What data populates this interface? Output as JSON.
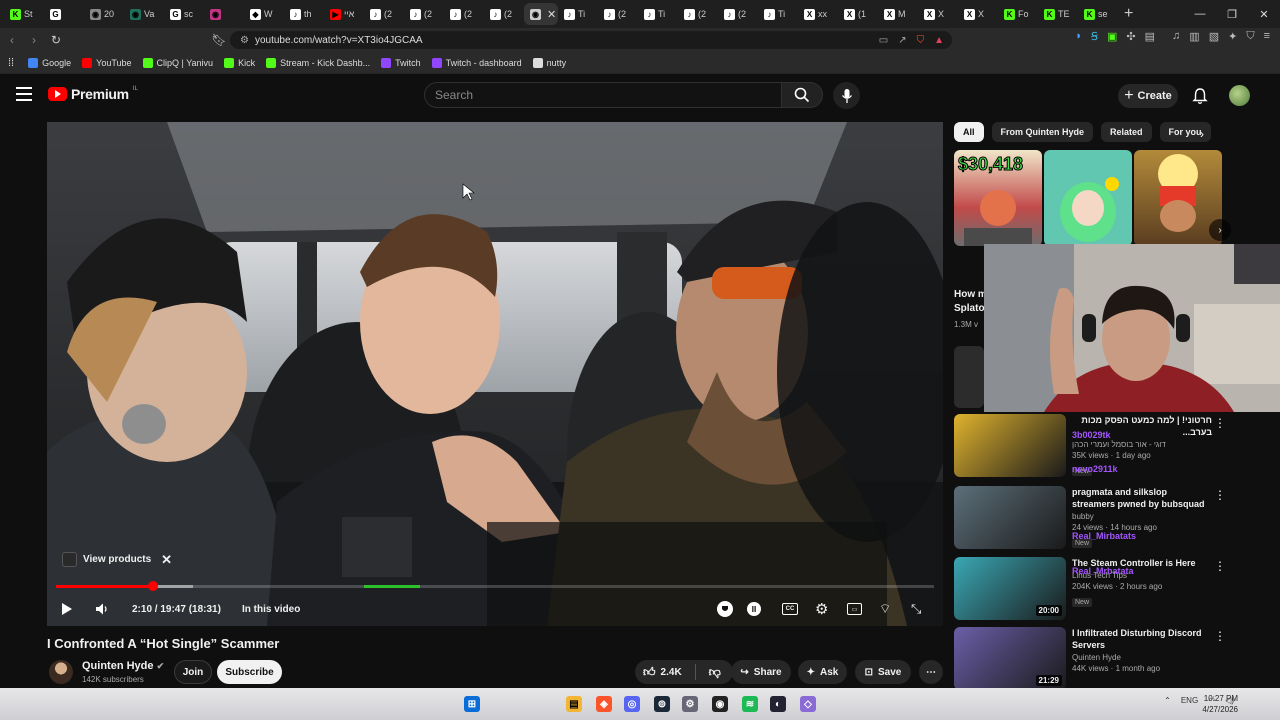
{
  "browser": {
    "tabs": [
      {
        "label": "St",
        "color": "#53fc18",
        "glyph": "K"
      },
      {
        "label": "",
        "color": "#ffffff",
        "glyph": "G"
      },
      {
        "label": "20",
        "color": "#888888",
        "glyph": "◉"
      },
      {
        "label": "Va",
        "color": "#1f6f5c",
        "glyph": "◉"
      },
      {
        "label": "sc",
        "color": "#ffffff",
        "glyph": "G"
      },
      {
        "label": "",
        "color": "#c13584",
        "glyph": "◉"
      },
      {
        "label": "W",
        "color": "#ffffff",
        "glyph": "◆"
      },
      {
        "label": "th",
        "color": "#ffffff",
        "glyph": "♪"
      },
      {
        "label": "איי",
        "color": "#ff0000",
        "glyph": "▶"
      },
      {
        "label": "(2",
        "color": "#ffffff",
        "glyph": "♪"
      },
      {
        "label": "(2",
        "color": "#ffffff",
        "glyph": "♪"
      },
      {
        "label": "(2",
        "color": "#ffffff",
        "glyph": "♪"
      },
      {
        "label": "(2",
        "color": "#ffffff",
        "glyph": "♪"
      },
      {
        "label": "",
        "color": "#cccccc",
        "glyph": "◉",
        "active": true
      },
      {
        "label": "Ti",
        "color": "#ffffff",
        "glyph": "♪"
      },
      {
        "label": "(2",
        "color": "#ffffff",
        "glyph": "♪"
      },
      {
        "label": "Ti",
        "color": "#ffffff",
        "glyph": "♪"
      },
      {
        "label": "(2",
        "color": "#ffffff",
        "glyph": "♪"
      },
      {
        "label": "(2",
        "color": "#ffffff",
        "glyph": "♪"
      },
      {
        "label": "Ti",
        "color": "#ffffff",
        "glyph": "♪"
      },
      {
        "label": "xx",
        "color": "#ffffff",
        "glyph": "X"
      },
      {
        "label": "(1",
        "color": "#ffffff",
        "glyph": "X"
      },
      {
        "label": "M",
        "color": "#ffffff",
        "glyph": "X"
      },
      {
        "label": "X",
        "color": "#ffffff",
        "glyph": "X"
      },
      {
        "label": "X",
        "color": "#ffffff",
        "glyph": "X"
      },
      {
        "label": "Fo",
        "color": "#53fc18",
        "glyph": "K"
      },
      {
        "label": "TE",
        "color": "#53fc18",
        "glyph": "K"
      },
      {
        "label": "se",
        "color": "#53fc18",
        "glyph": "K"
      }
    ],
    "new_tab": "+",
    "url": "youtube.com/watch?v=XT3io4JGCAA",
    "bookmarks": [
      {
        "label": "Google",
        "color": "#4285f4"
      },
      {
        "label": "YouTube",
        "color": "#ff0000"
      },
      {
        "label": "ClipQ | Yanivu",
        "color": "#53fc18"
      },
      {
        "label": "Kick",
        "color": "#53fc18"
      },
      {
        "label": "Stream - Kick Dashb...",
        "color": "#53fc18"
      },
      {
        "label": "Twitch",
        "color": "#9146ff"
      },
      {
        "label": "Twitch - dashboard",
        "color": "#9146ff"
      },
      {
        "label": "nutty",
        "color": "#dddddd"
      }
    ]
  },
  "youtube": {
    "logo_text": "Premium",
    "logo_sup": "IL",
    "search_placeholder": "Search",
    "create_label": "Create"
  },
  "player": {
    "view_products": "View products",
    "time": "2:10 / 19:47 (18:31)",
    "in_this_video": "In this video",
    "progress_played": 0.11,
    "progress_buffered": 0.156
  },
  "video": {
    "title": "I Confronted A “Hot Single” Scammer",
    "channel": "Quinten Hyde",
    "subscribers": "142K subscribers",
    "join_label": "Join",
    "subscribe_label": "Subscribe",
    "likes": "2.4K",
    "share_label": "Share",
    "ask_label": "Ask",
    "save_label": "Save"
  },
  "sidebar": {
    "chips": [
      "All",
      "From Quinten Hyde",
      "Related",
      "For you"
    ],
    "short1_price": "$30,418",
    "partial_title": "How m\nSplato",
    "partial_views": "1.3M v",
    "recommendations": [
      {
        "title": "חרטוני! | למה כמעט הפסק מכות בערב...",
        "channel": "דוגי - אור בוסמל ועמרי הכהן",
        "meta": "35K views · 1 day ago",
        "badge": "New",
        "duration": "",
        "thumb": "#e0b32e"
      },
      {
        "title": "pragmata and silkslop streamers pwned by bubsquad",
        "channel": "bubby",
        "meta": "24 views · 14 hours ago",
        "badge": "New",
        "duration": "",
        "thumb": "#5c6f7a"
      },
      {
        "title": "The Steam Controller is Here",
        "channel": "Linus Tech Tips",
        "meta": "204K views · 2 hours ago",
        "badge": "New",
        "duration": "20:00",
        "thumb": "#3aa8b5"
      },
      {
        "title": "I Infiltrated Disturbing Discord Servers",
        "channel": "Quinten Hyde",
        "meta": "44K views · 1 month ago",
        "badge": "",
        "duration": "21:29",
        "thumb": "#6a5fa8"
      }
    ],
    "chat_overlays": [
      "3b0029tk",
      "nevo2911k",
      "Real_Mirbatats",
      "Real_Mrbatata"
    ]
  },
  "taskbar": {
    "language": "ENG",
    "time": "10:27 PM",
    "date": "4/27/2026"
  }
}
